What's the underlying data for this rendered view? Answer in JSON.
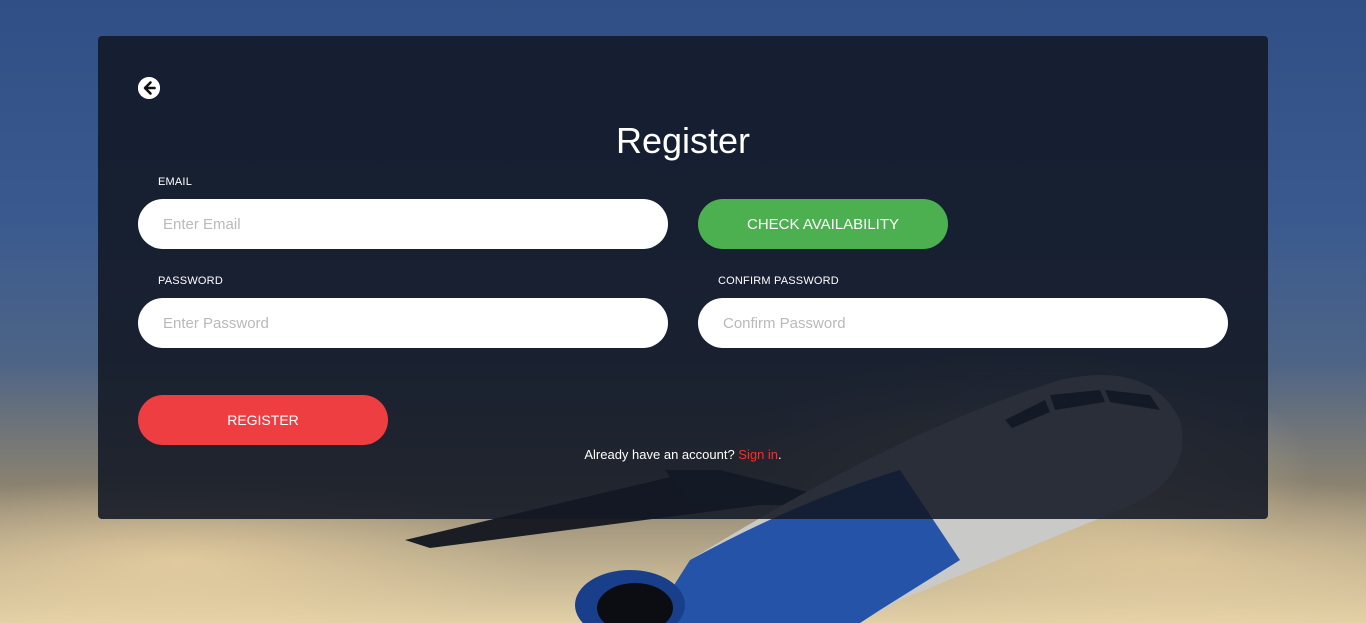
{
  "colors": {
    "accent_green": "#4caf50",
    "accent_red": "#ef3e42",
    "link_red": "#ff2a2a"
  },
  "back": {
    "icon": "arrow-left-circle-icon"
  },
  "form": {
    "title": "Register",
    "email": {
      "label": "EMAIL",
      "value": "",
      "placeholder": "Enter Email"
    },
    "check_availability_label": "CHECK AVAILABILITY",
    "password": {
      "label": "PASSWORD",
      "value": "",
      "placeholder": "Enter Password"
    },
    "confirm_password": {
      "label": "CONFIRM PASSWORD",
      "value": "",
      "placeholder": "Confirm Password"
    },
    "register_label": "REGISTER"
  },
  "signin": {
    "prompt": "Already have an account? ",
    "link_text": "Sign in",
    "suffix": "."
  }
}
